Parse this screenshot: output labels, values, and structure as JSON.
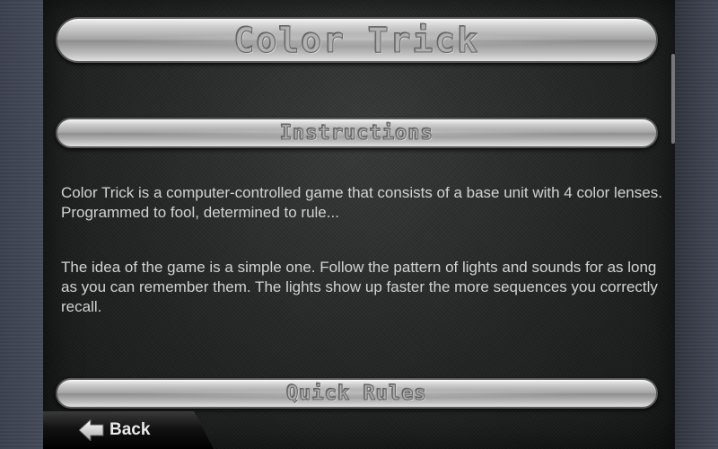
{
  "header": {
    "title": "Color Trick"
  },
  "sections": {
    "instructions_title": "Instructions",
    "quick_rules_title": "Quick Rules"
  },
  "content": {
    "paragraph_1": "Color Trick is a computer-controlled game that consists of a base unit with 4 color lenses. Programmed to fool, determined to rule...",
    "paragraph_2": "The idea of the game is a simple one. Follow the pattern of lights and sounds for as long as you can remember them. The lights show up faster the more sequences you correctly recall."
  },
  "navigation": {
    "back_label": "Back",
    "back_icon": "left-arrow-icon"
  },
  "colors": {
    "background": "#3e4350",
    "panel": "#242626",
    "text": "#d2d2d2",
    "pill_silver": "#b0b0b0"
  }
}
